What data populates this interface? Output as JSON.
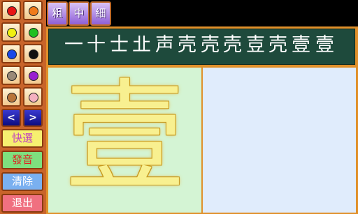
{
  "palette": {
    "colors": [
      {
        "name": "red",
        "hex": "#e81414"
      },
      {
        "name": "orange",
        "hex": "#f07a1a"
      },
      {
        "name": "yellow",
        "hex": "#f0f010"
      },
      {
        "name": "green",
        "hex": "#20c020"
      },
      {
        "name": "blue",
        "hex": "#1848e8"
      },
      {
        "name": "black",
        "hex": "#101010"
      },
      {
        "name": "gray",
        "hex": "#9a8a78"
      },
      {
        "name": "purple",
        "hex": "#9a20d0"
      },
      {
        "name": "brown",
        "hex": "#b8743a"
      },
      {
        "name": "pink",
        "hex": "#f4b0c0"
      }
    ],
    "prev_label": "<",
    "next_label": ">"
  },
  "commands": {
    "quick_select": "快選",
    "pronounce": "發音",
    "clear": "清除",
    "exit": "退出",
    "colors": {
      "quick_select": "#f6f070",
      "pronounce": "#7ee07e",
      "clear": "#7ab0f0",
      "exit": "#f07080"
    },
    "text_colors": {
      "quick_select": "#c040c0",
      "pronounce": "#e02020",
      "clear": "#ffffff",
      "exit": "#ffffff"
    }
  },
  "brush": {
    "thick": "粗",
    "medium": "中",
    "thin": "細"
  },
  "strokes": [
    "一",
    "十",
    "士",
    "㐀",
    "声",
    "壳",
    "壳",
    "壳",
    "壴",
    "壳",
    "壹",
    "壹"
  ],
  "character": "壹"
}
